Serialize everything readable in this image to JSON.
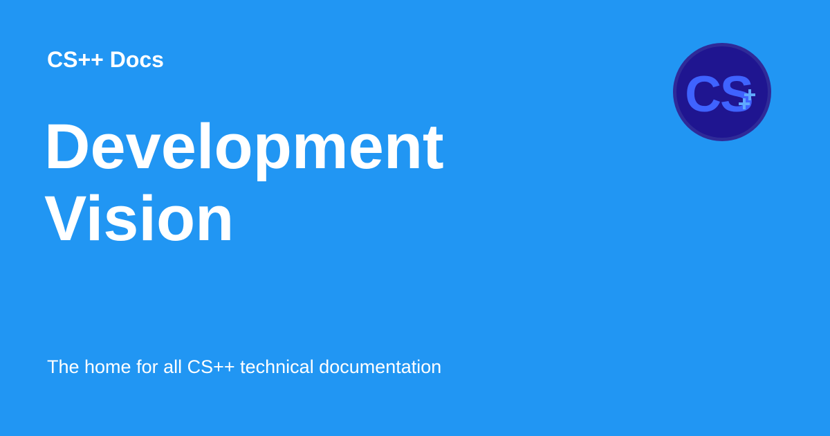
{
  "site": {
    "name": "CS++ Docs"
  },
  "page": {
    "title_lines": [
      "Development",
      "Vision"
    ],
    "description": "The home for all CS++ technical documentation"
  },
  "logo": {
    "text": "CS",
    "plus_mark": "++"
  },
  "colors": {
    "background": "#2196f3",
    "text": "#ffffff",
    "logo_ring": "#26208f",
    "logo_inner": "#1f1590",
    "logo_letters": "#3f63ff",
    "logo_plus": "#5fa8ff"
  }
}
